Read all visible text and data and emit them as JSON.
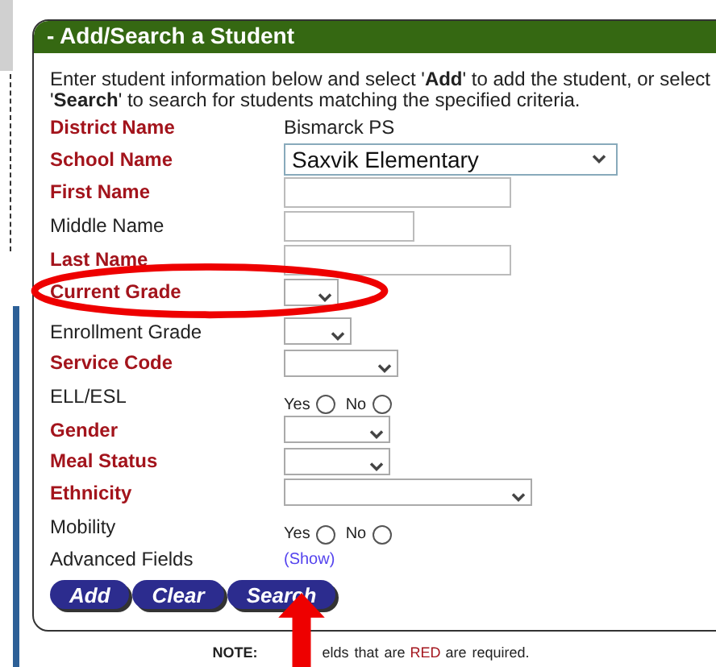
{
  "panel": {
    "title": "- Add/Search a Student",
    "intro": "Enter student information below and select '**Add**' to add the student, or select '**Search**' to search for students matching the specified criteria.",
    "fields": [
      {
        "label": "District Name",
        "required": true,
        "kind": "text",
        "value": "Bismarck PS"
      },
      {
        "label": "School Name",
        "required": true,
        "kind": "select",
        "value": "Saxvik Elementary"
      },
      {
        "label": "First Name",
        "required": true,
        "kind": "input"
      },
      {
        "label": "Middle Name",
        "required": false,
        "kind": "input"
      },
      {
        "label": "Last Name",
        "required": true,
        "kind": "input"
      },
      {
        "label": "Current Grade",
        "required": true,
        "kind": "select"
      },
      {
        "label": "Enrollment Grade",
        "required": false,
        "kind": "select"
      },
      {
        "label": "Service Code",
        "required": true,
        "kind": "select"
      },
      {
        "label": "ELL/ESL",
        "required": false,
        "kind": "radio",
        "options": [
          {
            "label": "Yes",
            "selected": false
          },
          {
            "label": "No",
            "selected": false
          }
        ]
      },
      {
        "label": "Gender",
        "required": true,
        "kind": "select"
      },
      {
        "label": "Meal Status",
        "required": true,
        "kind": "select"
      },
      {
        "label": "Ethnicity",
        "required": true,
        "kind": "select"
      },
      {
        "label": "Mobility",
        "required": false,
        "kind": "radio",
        "options": [
          {
            "label": "Yes",
            "selected": false
          },
          {
            "label": "No",
            "selected": false
          }
        ]
      },
      {
        "label": "Advanced Fields",
        "required": false,
        "kind": "link",
        "value": "(Show)"
      }
    ],
    "buttons": [
      "Add",
      "Clear",
      "Search"
    ]
  },
  "note": [
    {
      "text": "NOTE:",
      "kind": "bold"
    },
    {
      "text": "elds that are",
      "kind": "plain"
    },
    {
      "text": "RED",
      "kind": "red"
    },
    {
      "text": "are required.",
      "kind": "plain"
    }
  ]
}
